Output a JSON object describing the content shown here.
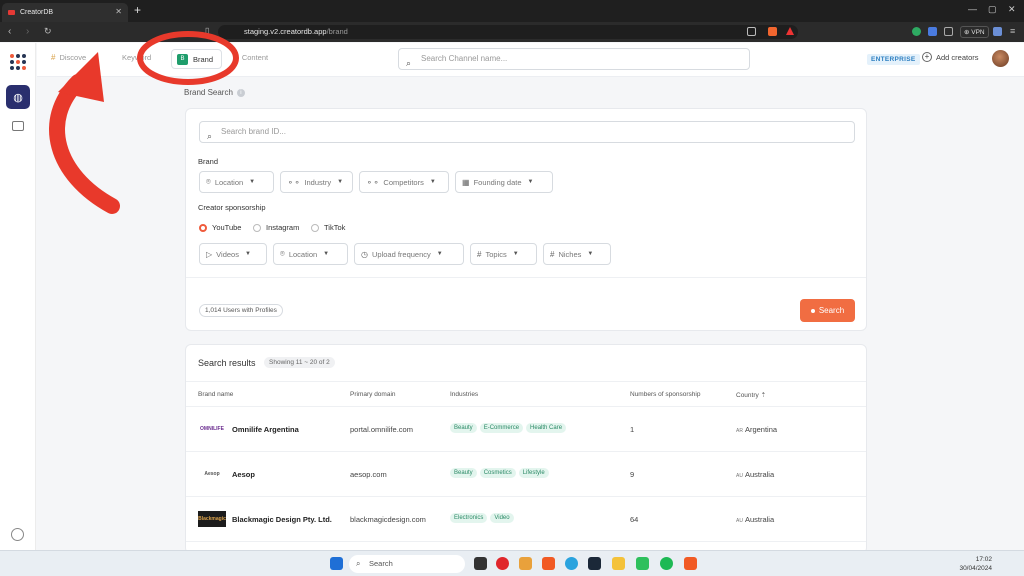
{
  "browser": {
    "tab_title": "CreatorDB",
    "tab_close": "✕",
    "new_tab": "+",
    "url_host": "staging.v2.creatordb.app",
    "url_path": "/brand",
    "vpn_label": "⊕ VPN"
  },
  "header": {
    "nav": {
      "discover": "Discove",
      "keyword": "Keyword",
      "brand": "Brand",
      "content": "Content"
    },
    "channel_search_placeholder": "Search Channel name...",
    "badge": "ENTERPRISE",
    "add_creators": "Add creators"
  },
  "brand_search": {
    "title": "Brand Search",
    "search_placeholder": "Search brand ID...",
    "brand_label": "Brand",
    "brand_filters": [
      "Location",
      "Industry",
      "Competitors",
      "Founding date"
    ],
    "sponsorship_label": "Creator sponsorship",
    "platforms": [
      "YouTube",
      "Instagram",
      "TikTok"
    ],
    "selected_platform": "YouTube",
    "sponsorship_filters": [
      "Videos",
      "Location",
      "Upload frequency",
      "Topics",
      "Niches"
    ],
    "users_count": "1,014 Users with Profiles",
    "search_button": "Search"
  },
  "results": {
    "title": "Search results",
    "showing": "Showing 11 ~ 20 of 2",
    "columns": [
      "Brand name",
      "Primary domain",
      "Industries",
      "Numbers of sponsorship",
      "Country"
    ],
    "rows": [
      {
        "logo_text": "OMNILIFE",
        "name": "Omnilife Argentina",
        "domain": "portal.omnilife.com",
        "industries": [
          "Beauty",
          "E-Commerce",
          "Health Care"
        ],
        "sponsorships": "1",
        "country_code": "AR",
        "country": "Argentina"
      },
      {
        "logo_text": "Aesop",
        "name": "Aesop",
        "domain": "aesop.com",
        "industries": [
          "Beauty",
          "Cosmetics",
          "Lifestyle"
        ],
        "sponsorships": "9",
        "country_code": "AU",
        "country": "Australia"
      },
      {
        "logo_text": "Blackmagic",
        "name": "Blackmagic Design Pty. Ltd.",
        "domain": "blackmagicdesign.com",
        "industries": [
          "Electronics",
          "Video"
        ],
        "sponsorships": "64",
        "country_code": "AU",
        "country": "Australia"
      }
    ]
  },
  "taskbar": {
    "search_label": "Search",
    "time": "17:02",
    "date": "30/04/2024"
  },
  "colors": {
    "accent": "#f16d42",
    "brand_green": "#1f9d6c",
    "nav_dark": "#2a2f6e",
    "annotation_red": "#e8392b"
  }
}
